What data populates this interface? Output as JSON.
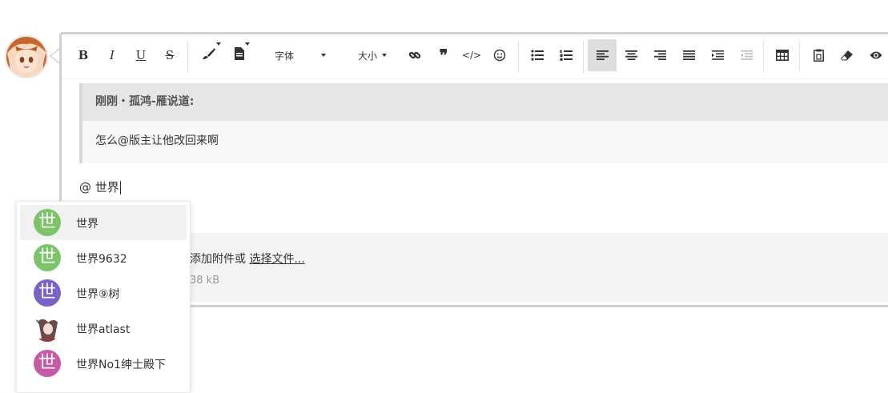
{
  "toolbar": {
    "font_label": "字体",
    "size_label": "大小",
    "buttons": [
      {
        "name": "bold-button",
        "glyph": "B"
      },
      {
        "name": "italic-button",
        "glyph": "I"
      },
      {
        "name": "underline-button",
        "glyph": "U"
      },
      {
        "name": "strikethrough-button",
        "glyph": "S"
      }
    ],
    "active_button": "align-left-button"
  },
  "quote": {
    "header": "刚刚・孤鸿-雁说道:",
    "body": "怎么@版主让他改回来啊"
  },
  "editor": {
    "typed_text": "@ 世界"
  },
  "attachment": {
    "prompt_fragment": "添加附件或 ",
    "link_text": "选择文件...",
    "size_fragment": "38 kB"
  },
  "mentions": {
    "items": [
      {
        "label": "世界",
        "avatar_char": "世",
        "avatar_color": "#7cc46a",
        "selected": true
      },
      {
        "label": "世界9632",
        "avatar_char": "世",
        "avatar_color": "#7cc46a",
        "selected": false
      },
      {
        "label": "世界⑨树",
        "avatar_char": "世",
        "avatar_color": "#7b63c6",
        "selected": false
      },
      {
        "label": "世界atlast",
        "avatar_char": "",
        "avatar_color": "#ffffff",
        "selected": false
      },
      {
        "label": "世界No1绅士殿下",
        "avatar_char": "世",
        "avatar_color": "#c65aa6",
        "selected": false
      }
    ]
  }
}
